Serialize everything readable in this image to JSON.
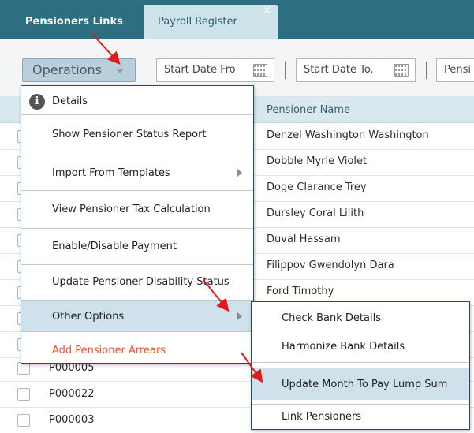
{
  "tabs": [
    {
      "label": "Pensioners Links"
    },
    {
      "label": "Payroll Register",
      "close": "×"
    }
  ],
  "toolbar": {
    "operations_label": "Operations",
    "start_date_from": "Start Date Fro",
    "start_date_to": "Start Date To.",
    "pensioner_filter": "Pensi"
  },
  "grid": {
    "column_header": "Pensioner Name",
    "names": [
      "Denzel Washington Washington",
      "Dobble Myrle Violet",
      "Doge Clarance Trey",
      "Dursley Coral Lilith",
      "Duval Hassam",
      "Filippov Gwendolyn Dara",
      "Ford Timothy"
    ],
    "ids": [
      "P000005",
      "P000022",
      "P000003"
    ]
  },
  "menu": {
    "details": "Details",
    "show_status_report": "Show Pensioner Status Report",
    "import_templates": "Import From Templates",
    "view_tax_calc": "View Pensioner Tax Calculation",
    "enable_disable_payment": "Enable/Disable Payment",
    "update_disability": "Update Pensioner Disability Status",
    "other_options": "Other Options",
    "add_arrears": "Add Pensioner Arrears"
  },
  "submenu": {
    "check_bank": "Check Bank Details",
    "harmonize_bank": "Harmonize Bank Details",
    "update_month_lump_sum": "Update Month To Pay Lump Sum",
    "link_pensioners": "Link Pensioners"
  },
  "colors": {
    "tabbar": "#2d6f81",
    "accent_red": "#e8542a",
    "hover": "#cfe1ea",
    "menu_border": "#1f4f66"
  }
}
